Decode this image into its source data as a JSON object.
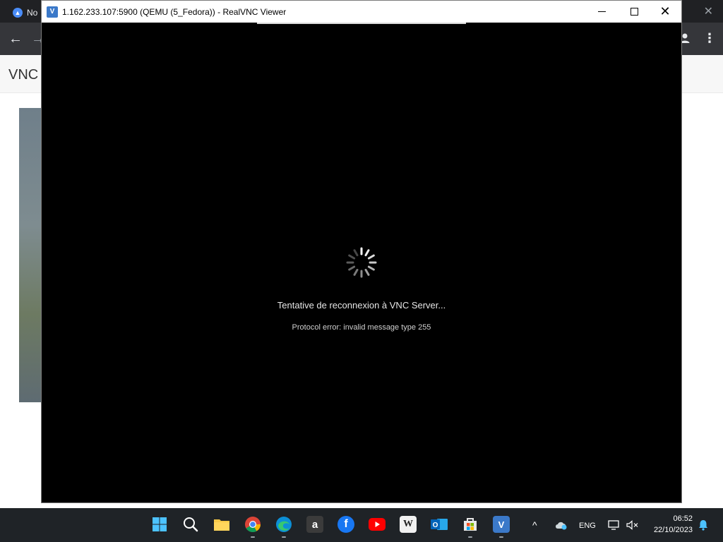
{
  "background_browser": {
    "tab_label": "No",
    "heading": "VNC"
  },
  "vnc_window": {
    "title": "1.162.233.107:5900 (QEMU (5_Fedora)) - RealVNC Viewer",
    "status_message": "Tentative de reconnexion à VNC Server...",
    "error_message": "Protocol error: invalid message type 255"
  },
  "taskbar": {
    "icons": [
      "start-icon",
      "search-icon",
      "file-explorer-icon",
      "chrome-icon",
      "edge-icon",
      "amazon-icon",
      "facebook-icon",
      "youtube-icon",
      "wikipedia-icon",
      "outlook-icon",
      "store-icon",
      "realvnc-icon"
    ],
    "language": "ENG",
    "time": "06:52",
    "date": "22/10/2023"
  }
}
